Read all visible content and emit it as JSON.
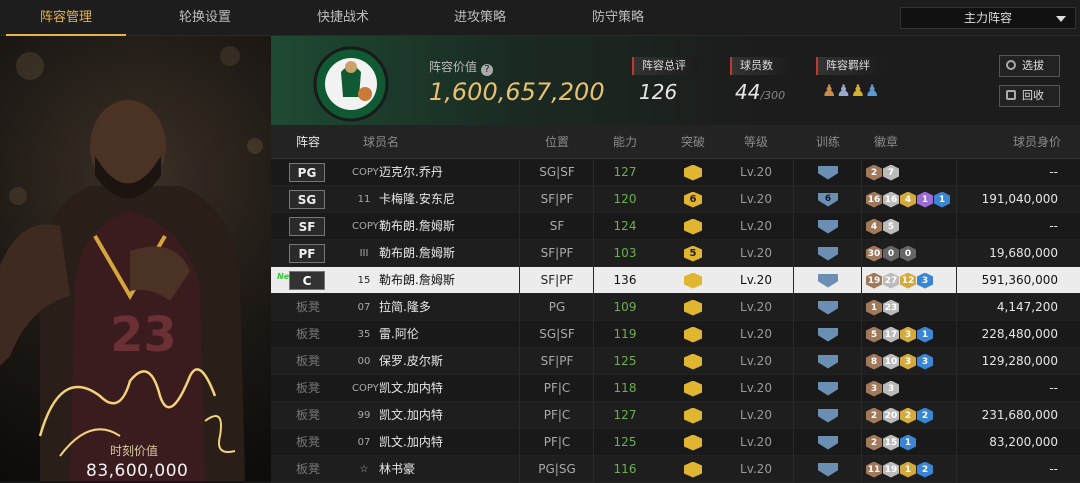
{
  "nav": {
    "tabs": [
      "阵容管理",
      "轮换设置",
      "快捷战术",
      "进攻策略",
      "防守策略"
    ],
    "dropdown": "主力阵容"
  },
  "card": {
    "value_label": "时刻价值",
    "value": "83,600,000"
  },
  "header": {
    "lineup_value_label": "阵容价值",
    "lineup_value": "1,600,657,200",
    "rating_label": "阵容总评",
    "rating": "126",
    "player_count_label": "球员数",
    "player_count": "44",
    "player_count_max": "/300",
    "bond_label": "阵容羁绊",
    "btn_pick": "选拔",
    "btn_recycle": "回收"
  },
  "columns": [
    "阵容",
    "球员名",
    "位置",
    "能力",
    "突破",
    "等级",
    "训练",
    "徽章",
    "球员身价"
  ],
  "rows": [
    {
      "slot": "PG",
      "num": "COPY",
      "name": "迈克尔.乔丹",
      "pos": "SG|SF",
      "ability": "127",
      "breakthrough": "",
      "level": "Lv.20",
      "train": "",
      "badges": [
        [
          "2",
          "#a0785a"
        ],
        [
          "7",
          "#bbb"
        ]
      ],
      "price": "--"
    },
    {
      "slot": "SG",
      "num": "11",
      "name": "卡梅隆.安东尼",
      "pos": "SF|PF",
      "ability": "120",
      "breakthrough": "6",
      "level": "Lv.20",
      "train": "6",
      "badges": [
        [
          "16",
          "#a0785a"
        ],
        [
          "16",
          "#bbb"
        ],
        [
          "4",
          "#d4aa3c"
        ],
        [
          "1",
          "#9b6bd6"
        ],
        [
          "1",
          "#3a86d4"
        ]
      ],
      "price": "191,040,000"
    },
    {
      "slot": "SF",
      "num": "COPY",
      "name": "勒布朗.詹姆斯",
      "pos": "SF",
      "ability": "124",
      "breakthrough": "",
      "level": "Lv.20",
      "train": "",
      "badges": [
        [
          "4",
          "#a0785a"
        ],
        [
          "5",
          "#bbb"
        ]
      ],
      "price": "--"
    },
    {
      "slot": "PF",
      "num": "III",
      "name": "勒布朗.詹姆斯",
      "pos": "SF|PF",
      "ability": "103",
      "breakthrough": "5",
      "level": "Lv.20",
      "train": "",
      "badges": [
        [
          "30",
          "#a0785a"
        ],
        [
          "0",
          "#666"
        ],
        [
          "0",
          "#666"
        ]
      ],
      "price": "19,680,000"
    },
    {
      "slot": "C",
      "num": "15",
      "name": "勒布朗.詹姆斯",
      "pos": "SF|PF",
      "ability": "136",
      "breakthrough": "",
      "level": "Lv.20",
      "train": "",
      "badges": [
        [
          "19",
          "#a0785a"
        ],
        [
          "27",
          "#bbb"
        ],
        [
          "12",
          "#d4aa3c"
        ],
        [
          "3",
          "#3a86d4"
        ]
      ],
      "price": "591,360,000",
      "new": "New"
    },
    {
      "slot": "板凳",
      "num": "07",
      "name": "拉简.隆多",
      "pos": "PG",
      "ability": "109",
      "breakthrough": "",
      "level": "Lv.20",
      "train": "",
      "badges": [
        [
          "1",
          "#a0785a"
        ],
        [
          "23",
          "#bbb"
        ]
      ],
      "price": "4,147,200"
    },
    {
      "slot": "板凳",
      "num": "35",
      "name": "雷.阿伦",
      "pos": "SG|SF",
      "ability": "119",
      "breakthrough": "",
      "level": "Lv.20",
      "train": "",
      "badges": [
        [
          "5",
          "#a0785a"
        ],
        [
          "17",
          "#bbb"
        ],
        [
          "3",
          "#d4aa3c"
        ],
        [
          "1",
          "#3a86d4"
        ]
      ],
      "price": "228,480,000"
    },
    {
      "slot": "板凳",
      "num": "00",
      "name": "保罗.皮尔斯",
      "pos": "SF|PF",
      "ability": "125",
      "breakthrough": "",
      "level": "Lv.20",
      "train": "",
      "badges": [
        [
          "8",
          "#a0785a"
        ],
        [
          "10",
          "#bbb"
        ],
        [
          "3",
          "#d4aa3c"
        ],
        [
          "3",
          "#3a86d4"
        ]
      ],
      "price": "129,280,000"
    },
    {
      "slot": "板凳",
      "num": "COPY",
      "name": "凯文.加内特",
      "pos": "PF|C",
      "ability": "118",
      "breakthrough": "",
      "level": "Lv.20",
      "train": "",
      "badges": [
        [
          "3",
          "#a0785a"
        ],
        [
          "3",
          "#bbb"
        ]
      ],
      "price": "--"
    },
    {
      "slot": "板凳",
      "num": "99",
      "name": "凯文.加内特",
      "pos": "PF|C",
      "ability": "127",
      "breakthrough": "",
      "level": "Lv.20",
      "train": "",
      "badges": [
        [
          "2",
          "#a0785a"
        ],
        [
          "20",
          "#bbb"
        ],
        [
          "2",
          "#d4aa3c"
        ],
        [
          "2",
          "#3a86d4"
        ]
      ],
      "price": "231,680,000"
    },
    {
      "slot": "板凳",
      "num": "07",
      "name": "凯文.加内特",
      "pos": "PF|C",
      "ability": "125",
      "breakthrough": "",
      "level": "Lv.20",
      "train": "",
      "badges": [
        [
          "2",
          "#a0785a"
        ],
        [
          "15",
          "#bbb"
        ],
        [
          "1",
          "#3a86d4"
        ]
      ],
      "price": "83,200,000"
    },
    {
      "slot": "板凳",
      "num": "☆",
      "name": "林书豪",
      "pos": "PG|SG",
      "ability": "116",
      "breakthrough": "",
      "level": "Lv.20",
      "train": "",
      "badges": [
        [
          "11",
          "#a0785a"
        ],
        [
          "19",
          "#bbb"
        ],
        [
          "1",
          "#d4aa3c"
        ],
        [
          "2",
          "#3a86d4"
        ]
      ],
      "price": "--"
    }
  ]
}
